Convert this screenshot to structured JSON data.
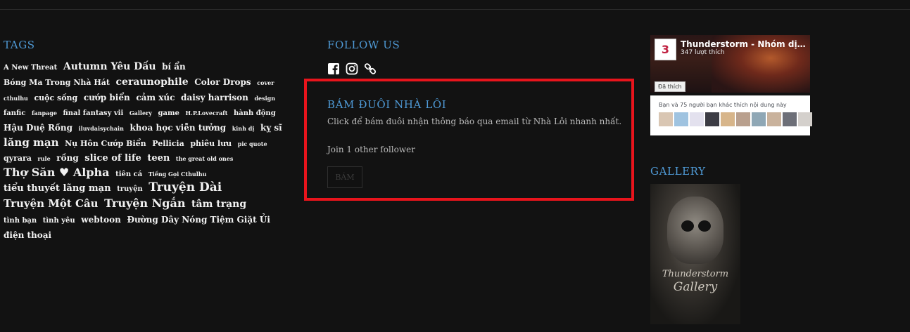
{
  "tags": {
    "title": "TAGS",
    "items": [
      {
        "label": "A New Threat",
        "size": 10
      },
      {
        "label": "Autumn Yêu Dấu",
        "size": 14
      },
      {
        "label": "bí ẩn",
        "size": 12
      },
      {
        "label": "Bóng Ma Trong Nhà Hát",
        "size": 11
      },
      {
        "label": "ceraunophile",
        "size": 14
      },
      {
        "label": "Color Drops",
        "size": 12
      },
      {
        "label": "cover",
        "size": 8
      },
      {
        "label": "cthulhu",
        "size": 8
      },
      {
        "label": "cuộc sống",
        "size": 11
      },
      {
        "label": "cướp biển",
        "size": 12
      },
      {
        "label": "cảm xúc",
        "size": 12
      },
      {
        "label": "daisy harrison",
        "size": 12
      },
      {
        "label": "design",
        "size": 8
      },
      {
        "label": "fanfic",
        "size": 10
      },
      {
        "label": "fanpage",
        "size": 8
      },
      {
        "label": "final fantasy vii",
        "size": 10
      },
      {
        "label": "Gallery",
        "size": 8
      },
      {
        "label": "game",
        "size": 10
      },
      {
        "label": "H.P.Lovecraft",
        "size": 8
      },
      {
        "label": "hành động",
        "size": 10
      },
      {
        "label": "Hậu Duệ Rồng",
        "size": 12
      },
      {
        "label": "iluvdaisychain",
        "size": 8
      },
      {
        "label": "khoa học viễn tưởng",
        "size": 12
      },
      {
        "label": "kinh dị",
        "size": 8
      },
      {
        "label": "kỵ sĩ",
        "size": 12
      },
      {
        "label": "lăng mạn",
        "size": 15
      },
      {
        "label": "Nụ Hôn Cướp Biển",
        "size": 11
      },
      {
        "label": "Pellicia",
        "size": 11
      },
      {
        "label": "phiêu lưu",
        "size": 11
      },
      {
        "label": "pic quote",
        "size": 8
      },
      {
        "label": "qyrara",
        "size": 11
      },
      {
        "label": "rule",
        "size": 8
      },
      {
        "label": "rồng",
        "size": 12
      },
      {
        "label": "slice of life",
        "size": 13
      },
      {
        "label": "teen",
        "size": 13
      },
      {
        "label": "the great old ones",
        "size": 8
      },
      {
        "label": "Thợ Săn ♥ Alpha",
        "size": 16
      },
      {
        "label": "tiên cá",
        "size": 10
      },
      {
        "label": "Tiếng Gọi Cthulhu",
        "size": 8
      },
      {
        "label": "tiểu thuyết lãng mạn",
        "size": 13
      },
      {
        "label": "truyện",
        "size": 10
      },
      {
        "label": "Truyện Dài",
        "size": 17
      },
      {
        "label": "Truyện Một Câu",
        "size": 15
      },
      {
        "label": "Truyện Ngắn",
        "size": 16
      },
      {
        "label": "tâm trạng",
        "size": 14
      },
      {
        "label": "tình bạn",
        "size": 10
      },
      {
        "label": "tình yêu",
        "size": 10
      },
      {
        "label": "webtoon",
        "size": 12
      },
      {
        "label": "Đường Dây Nóng Tiệm Giặt Ủi",
        "size": 12
      },
      {
        "label": "điện thoại",
        "size": 12
      }
    ]
  },
  "follow": {
    "title": "FOLLOW US",
    "icons": [
      "facebook-icon",
      "instagram-icon",
      "link-icon"
    ]
  },
  "subscribe": {
    "title": "BÁM ĐUÔI NHÀ LÔI",
    "description": "Click để bám đuôi nhận thông báo qua email từ Nhà Lôi nhanh nhất.",
    "follower_count": "Join 1 other follower",
    "button_label": "BÁM",
    "highlight_color": "#e8141c"
  },
  "facebook": {
    "page_name": "Thunderstorm - Nhóm dịch ...",
    "likes": "347 lượt thích",
    "like_button": "Đã thích",
    "friends_text": "Bạn và 75 người bạn khác thích nội dung này"
  },
  "gallery": {
    "title": "GALLERY",
    "image_text": "Thunderstorm Gallery"
  },
  "colors": {
    "background": "#121212",
    "accent": "#4f9ad6",
    "text": "#f2f2f2"
  }
}
